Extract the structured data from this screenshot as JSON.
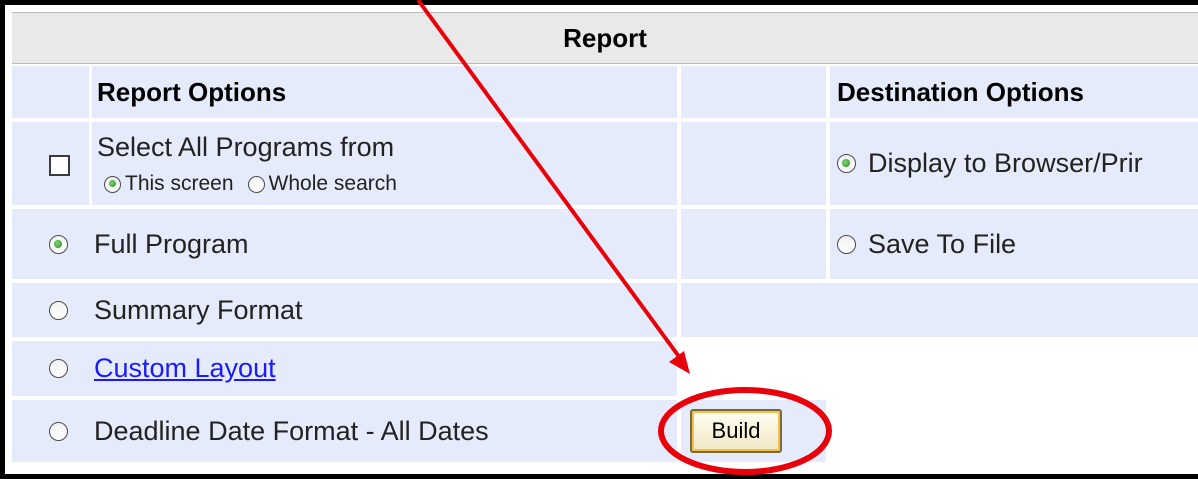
{
  "panel": {
    "title": "Report"
  },
  "report_options": {
    "header": "Report Options",
    "select_all_label": "Select All Programs from",
    "scope_this_screen": "This screen",
    "scope_whole_search": "Whole search",
    "full_program": "Full Program",
    "summary_format": "Summary Format",
    "custom_layout": "Custom Layout",
    "deadline_format": "Deadline Date Format - All Dates"
  },
  "destination_options": {
    "header": "Destination Options",
    "display_browser": "Display to Browser/Prir",
    "save_to_file": "Save To File"
  },
  "build_button": "Build",
  "annotation": {
    "color": "#e8000b"
  }
}
